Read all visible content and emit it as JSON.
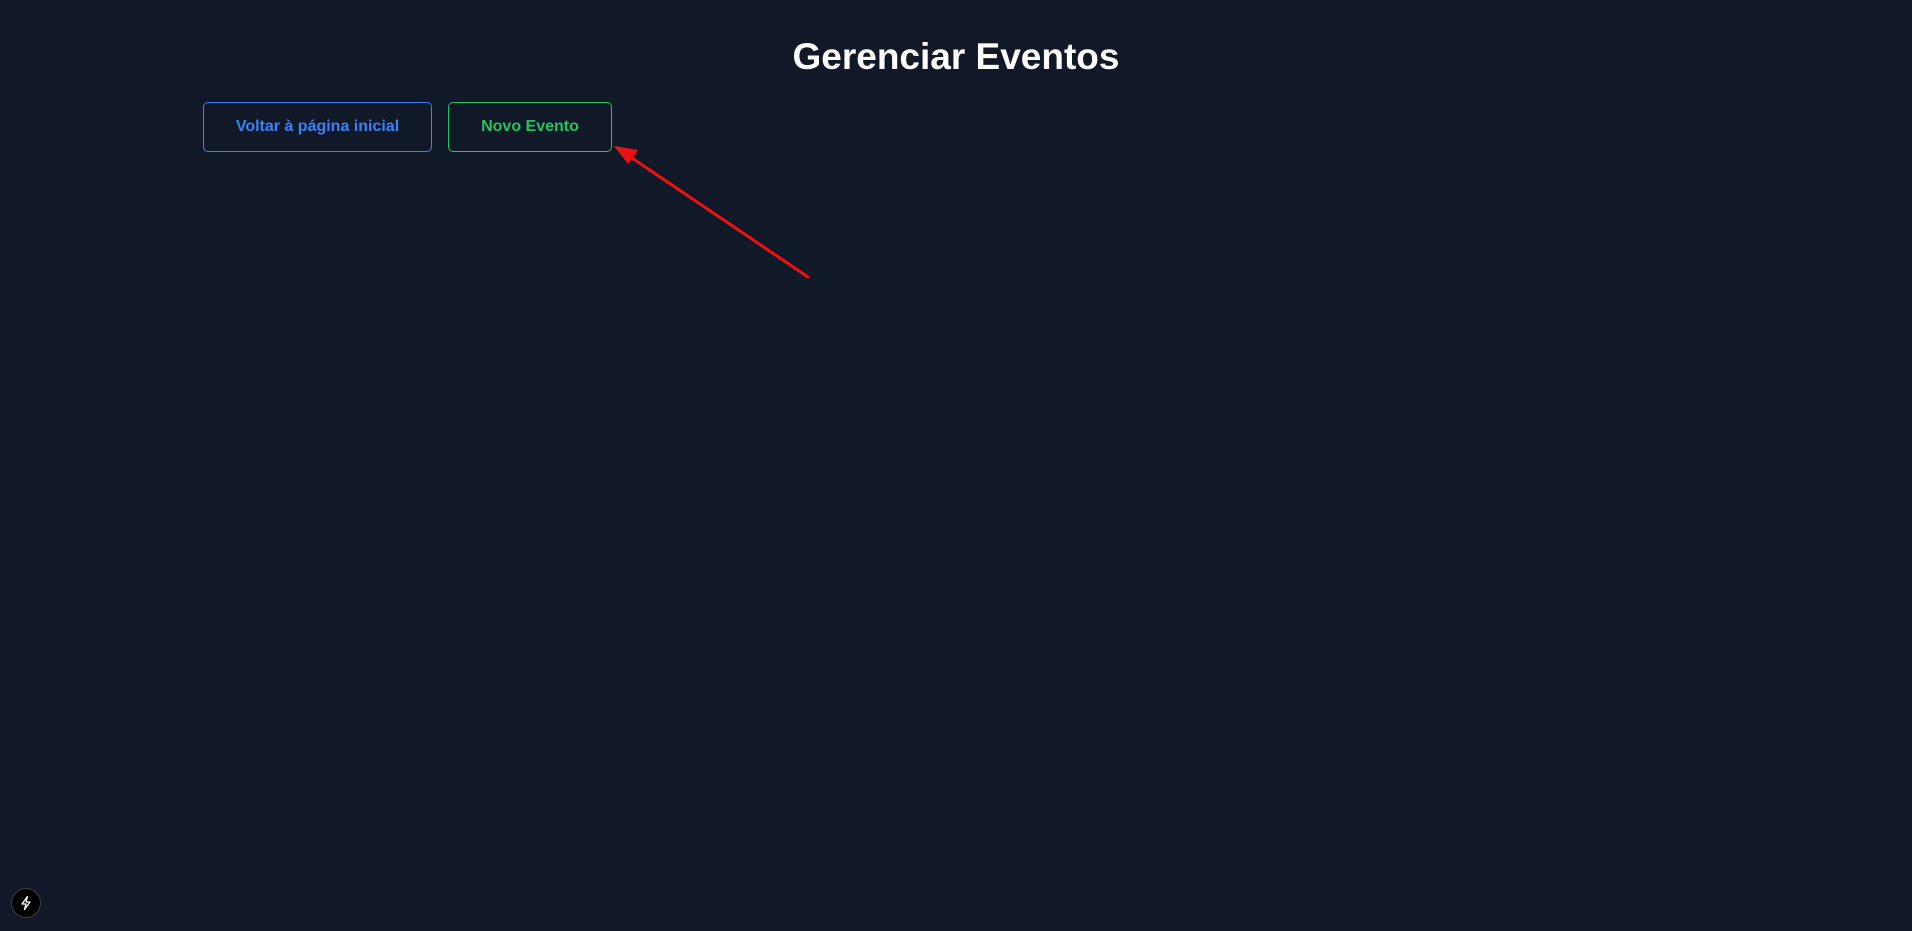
{
  "page": {
    "title": "Gerenciar Eventos"
  },
  "actions": {
    "back_label": "Voltar à página inicial",
    "new_event_label": "Novo Evento"
  },
  "annotation": {
    "type": "arrow",
    "color": "#ee1111",
    "points_to": "new-event-button"
  },
  "dev_badge": {
    "icon": "lightning-bolt-icon"
  },
  "colors": {
    "background": "#111827",
    "title": "#ffffff",
    "back_button": "#3b82f6",
    "new_event_button": "#22c55e"
  }
}
